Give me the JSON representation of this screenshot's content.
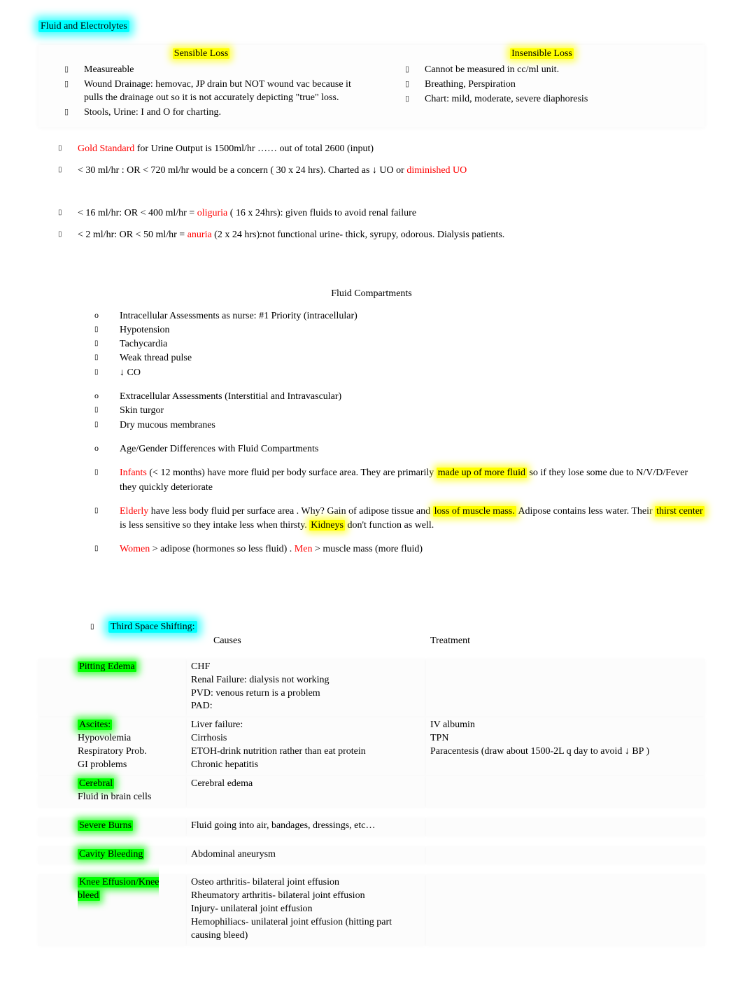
{
  "title": "Fluid and Electrolytes",
  "loss_columns": {
    "sensible": {
      "heading": "Sensible Loss",
      "items": [
        "Measureable",
        "Wound Drainage: hemovac, JP drain but NOT wound vac because it pulls the drainage out so it is not accurately depicting \"true\" loss.",
        "Stools, Urine: I and O for charting."
      ]
    },
    "insensible": {
      "heading": "Insensible Loss",
      "items": [
        "Cannot be measured in cc/ml unit.",
        "Breathing, Perspiration",
        "Chart: mild, moderate, severe diaphoresis"
      ]
    }
  },
  "urine_notes": {
    "gold_standard_label": "Gold Standard",
    "gold_standard_rest": "   for Urine Output is 1500ml/hr …… out of total 2600 (input)",
    "line2_a": "< 30 ml/hr : OR     < 720 ml/hr  would be a concern ( 30 x 24 hrs).  Charted as ↓ UO or ",
    "line2_b": "diminished UO",
    "line3_a": "< 16 ml/hr:  OR    < 400 ml/hr   =  ",
    "line3_term": "oliguria",
    "line3_b": "   ( 16 x 24hrs):  given fluids to avoid renal failure",
    "line4_a": "<  2  ml/hr:  OR    <  50  ml/hr    =  ",
    "line4_term": "anuria",
    "line4_b": "    (2 x 24 hrs):not functional urine- thick, syrupy, odorous. Dialysis patients."
  },
  "compartments": {
    "heading": "Fluid Compartments",
    "intra_head": "Intracellular Assessments as nurse: #1 Priority (intracellular)",
    "intra_items": [
      "Hypotension",
      "Tachycardia",
      "Weak thread pulse",
      "↓ CO"
    ],
    "extra_head": "Extracellular Assessments (Interstitial and Intravascular)",
    "extra_items": [
      "Skin turgor",
      "Dry mucous membranes"
    ],
    "age_head": "Age/Gender Differences with Fluid Compartments",
    "infants_label": "Infants",
    "infants_a": " (< 12 months)  have more fluid per body surface area.  They are primarily ",
    "infants_hl": "made up of more fluid",
    "infants_b": " so if they lose some due to N/V/D/Fever they quickly deteriorate",
    "elderly_label": "Elderly",
    "elderly_a": " have less body fluid per surface area .  Why? Gain of adipose tissue and ",
    "elderly_hl1": "loss of muscle mass.",
    "elderly_b": " Adipose contains less water. Their  ",
    "elderly_hl2": "thirst center",
    "elderly_c": " is less sensitive so they intake less when thirsty. ",
    "elderly_hl3": "Kidneys",
    "elderly_d": " don't function as well.",
    "women_label": "Women",
    "women_a": "  >  adipose (hormones so less fluid)   .  ",
    "men_label": "Men",
    "men_a": " > muscle mass (more fluid)"
  },
  "third_space": {
    "heading": "Third Space Shifting:",
    "col_causes": "Causes",
    "col_treatment": "Treatment",
    "rows": [
      {
        "name": "Pitting Edema",
        "hl": true,
        "sub": "",
        "causes": "CHF\nRenal Failure: dialysis not working\nPVD: venous return is a problem\nPAD:",
        "treatment": ""
      },
      {
        "name": "Ascites:",
        "hl": true,
        "sub": "Hypovolemia\nRespiratory Prob.\nGI problems",
        "causes": "Liver failure:\nCirrhosis\nETOH-drink nutrition rather than eat protein\nChronic hepatitis",
        "treatment": "IV albumin\nTPN\nParacentesis (draw about 1500-2L q day to avoid ↓ BP )"
      },
      {
        "name": "Cerebral",
        "hl": true,
        "sub": "Fluid in brain cells",
        "causes": "Cerebral edema",
        "treatment": ""
      },
      {
        "name": "Severe Burns",
        "hl": true,
        "sub": "",
        "causes": "Fluid going into air, bandages, dressings, etc…",
        "treatment": ""
      },
      {
        "name": "Cavity Bleeding",
        "hl": true,
        "sub": "",
        "causes": "Abdominal aneurysm",
        "treatment": ""
      },
      {
        "name": "Knee Effusion/Knee bleed",
        "hl": true,
        "sub": "",
        "causes": "Osteo arthritis- bilateral joint effusion\nRheumatory arthritis- bilateral joint effusion\nInjury- unilateral joint effusion\nHemophiliacs- unilateral joint effusion (hitting part causing bleed)",
        "treatment": ""
      }
    ]
  }
}
